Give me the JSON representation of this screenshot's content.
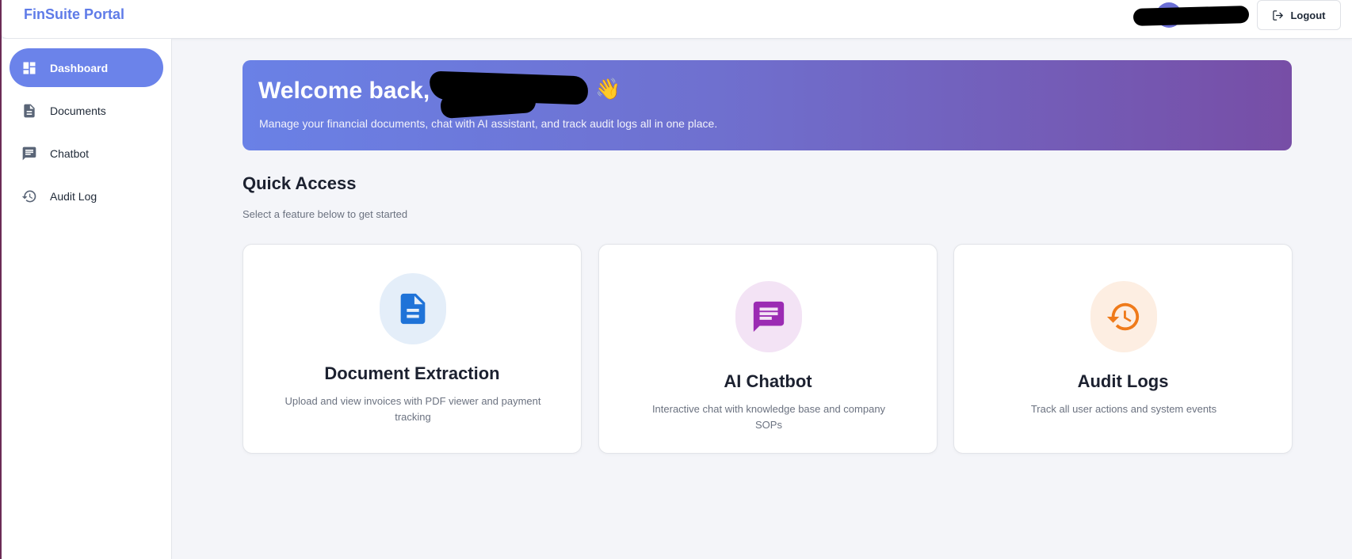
{
  "app": {
    "brand": "FinSuite Portal"
  },
  "header": {
    "logout_label": "Logout"
  },
  "sidebar": {
    "items": [
      {
        "label": "Dashboard",
        "icon": "dashboard-icon",
        "active": true
      },
      {
        "label": "Documents",
        "icon": "document-icon",
        "active": false
      },
      {
        "label": "Chatbot",
        "icon": "chat-icon",
        "active": false
      },
      {
        "label": "Audit Log",
        "icon": "history-icon",
        "active": false
      }
    ]
  },
  "hero": {
    "title": "Welcome back,",
    "wave": "👋",
    "subtitle": "Manage your financial documents, chat with AI assistant, and track audit logs all in one place."
  },
  "quick_access": {
    "title": "Quick Access",
    "subtitle": "Select a feature below to get started",
    "cards": [
      {
        "title": "Document Extraction",
        "description": "Upload and view invoices with PDF viewer and payment tracking",
        "icon": "document-icon",
        "icon_color": "#1f73d8",
        "bg_color": "#e4eef9"
      },
      {
        "title": "AI Chatbot",
        "description": "Interactive chat with knowledge base and company SOPs",
        "icon": "chat-icon",
        "icon_color": "#9b2bb3",
        "bg_color": "#f3e3f5"
      },
      {
        "title": "Audit Logs",
        "description": "Track all user actions and system events",
        "icon": "history-icon",
        "icon_color": "#ef7a1a",
        "bg_color": "#fdeee2"
      }
    ]
  },
  "colors": {
    "brand": "#5f7be8",
    "active_nav": "#6b83ea",
    "hero_start": "#6a81e6",
    "hero_end": "#774ea6"
  }
}
